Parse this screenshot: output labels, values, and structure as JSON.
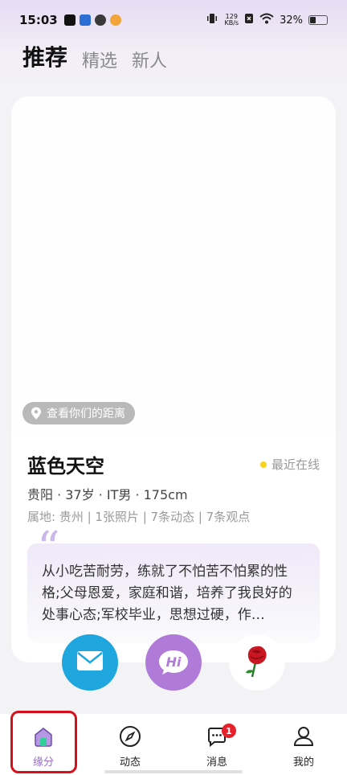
{
  "status_bar": {
    "time": "15:03",
    "net_speed_value": "129",
    "net_speed_unit": "KB/s",
    "battery": "32%"
  },
  "tabs": [
    {
      "label": "推荐"
    },
    {
      "label": "精选"
    },
    {
      "label": "新人"
    }
  ],
  "card": {
    "distance_button": "查看你们的距离",
    "name": "蓝色天空",
    "online_status": "最近在线",
    "basic_info": "贵阳 · 37岁 · IT男 · 175cm",
    "meta": "属地: 贵州 | 1张照片 | 7条动态 | 7条观点",
    "bio": "从小吃苦耐劳，练就了不怕苦不怕累的性格;父母恩爱，家庭和谐，培养了我良好的处事心态;军校毕业，思想过硬，作…"
  },
  "actions": {
    "hi_label": "Hi"
  },
  "nav": [
    {
      "label": "缘分"
    },
    {
      "label": "动态"
    },
    {
      "label": "消息",
      "badge": "1"
    },
    {
      "label": "我的"
    }
  ],
  "colors": {
    "accent": "#9b6bd1",
    "mail_button": "#1fa6de",
    "hi_button": "#b07bd8",
    "online_dot": "#f7d31c",
    "badge": "#e8202b",
    "highlight": "#d3101c"
  },
  "icons": [
    "vibrate-icon",
    "wifi-icon",
    "battery-icon",
    "location-pin-icon",
    "mail-icon",
    "rose-icon",
    "home-icon",
    "compass-icon",
    "chat-icon",
    "user-icon"
  ]
}
